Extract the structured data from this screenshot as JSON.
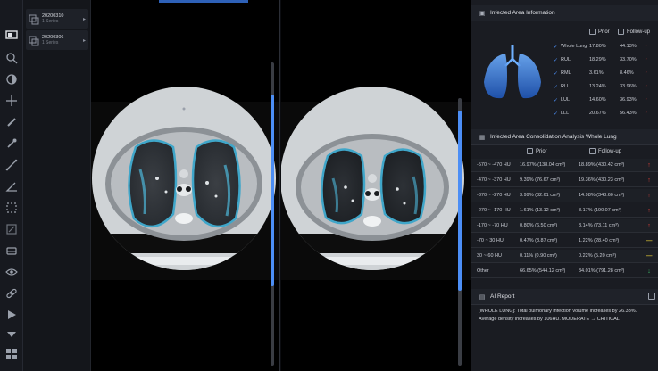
{
  "series": [
    {
      "date": "20200310",
      "count": "1 Series"
    },
    {
      "date": "20200306",
      "count": "1 Series"
    }
  ],
  "infected_area": {
    "title": "Infected Area Information",
    "col_prior": "Prior",
    "col_followup": "Follow-up",
    "rows": [
      {
        "name": "Whole Lung",
        "prior": "17.80%",
        "followup": "44.13%"
      },
      {
        "name": "RUL",
        "prior": "18.29%",
        "followup": "33.70%"
      },
      {
        "name": "RML",
        "prior": "3.61%",
        "followup": "8.46%"
      },
      {
        "name": "RLL",
        "prior": "13.24%",
        "followup": "33.96%"
      },
      {
        "name": "LUL",
        "prior": "14.60%",
        "followup": "36.93%"
      },
      {
        "name": "LLL",
        "prior": "20.67%",
        "followup": "56.43%"
      }
    ]
  },
  "consolidation": {
    "title": "Infected Area Consolidation Analysis Whole Lung",
    "col_prior": "Prior",
    "col_followup": "Follow-up",
    "rows": [
      {
        "range": "-570 ~ -470 HU",
        "prior": "16.97% (138.04 cm³)",
        "followup": "18.89% (430.42 cm³)",
        "trend": "up"
      },
      {
        "range": "-470 ~ -370 HU",
        "prior": "9.39% (76.67 cm³)",
        "followup": "19.36% (430.23 cm³)",
        "trend": "up"
      },
      {
        "range": "-370 ~ -270 HU",
        "prior": "3.99% (32.61 cm³)",
        "followup": "14.98% (348.60 cm³)",
        "trend": "up"
      },
      {
        "range": "-270 ~ -170 HU",
        "prior": "1.61% (13.12 cm³)",
        "followup": "8.17% (190.07 cm³)",
        "trend": "up"
      },
      {
        "range": "-170 ~ -70 HU",
        "prior": "0.80% (6.50 cm³)",
        "followup": "3.14% (73.11 cm³)",
        "trend": "up"
      },
      {
        "range": "-70 ~ 30 HU",
        "prior": "0.47% (3.87 cm³)",
        "followup": "1.22% (28.40 cm³)",
        "trend": "flat"
      },
      {
        "range": "30 ~ 60 HU",
        "prior": "0.11% (0.90 cm³)",
        "followup": "0.22% (5.20 cm³)",
        "trend": "flat"
      },
      {
        "range": "Other",
        "prior": "66.65% (544.12 cm³)",
        "followup": "34.01% (791.28 cm³)",
        "trend": "down"
      }
    ]
  },
  "ai_report": {
    "title": "AI Report",
    "text": "[WHOLE LUNG]: Total pulmonary infection volume increases by 26.33%. Average density increases by 106HU. MODERATE → CRITICAL"
  },
  "colors": {
    "accent": "#4c8ef5",
    "increase": "#e8413a",
    "decrease": "#3ec46d",
    "neutral": "#c8b233"
  }
}
